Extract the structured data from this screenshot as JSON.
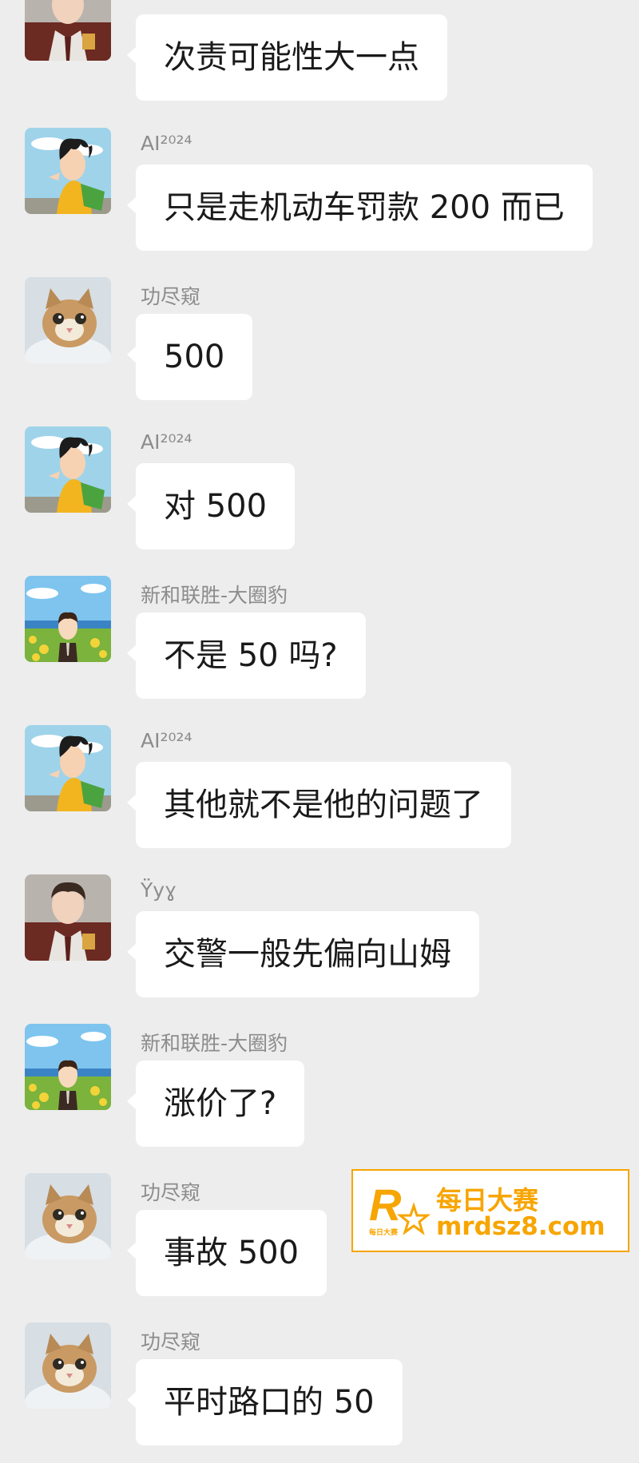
{
  "senders": {
    "yyy": "Ÿyɣ",
    "ai": "AI²⁰²⁴",
    "gong": "功尽窥",
    "xinhe": "新和联胜-大圈豹"
  },
  "messages": [
    {
      "sender": "",
      "text": "次责可能性大一点"
    },
    {
      "sender": "AI²⁰²⁴",
      "text": "只是走机动车罚款 200 而已"
    },
    {
      "sender": "功尽窥",
      "text": "500"
    },
    {
      "sender": "AI²⁰²⁴",
      "text": "对 500"
    },
    {
      "sender": "新和联胜-大圈豹",
      "text": "不是 50 吗?"
    },
    {
      "sender": "AI²⁰²⁴",
      "text": "其他就不是他的问题了"
    },
    {
      "sender": "Ÿyɣ",
      "text": "交警一般先偏向山姆"
    },
    {
      "sender": "新和联胜-大圈豹",
      "text": "涨价了?"
    },
    {
      "sender": "功尽窥",
      "text": "事故 500"
    },
    {
      "sender": "功尽窥",
      "text": "平时路口的 50"
    }
  ],
  "watermark": {
    "logo_letter": "R",
    "logo_caption": "每日大赛",
    "title": "每日大赛",
    "url": "mrdsz8.com",
    "color": "#f7a500"
  },
  "colors": {
    "background": "#ededed",
    "bubble": "#ffffff",
    "sender_name": "#8c8c8c"
  }
}
